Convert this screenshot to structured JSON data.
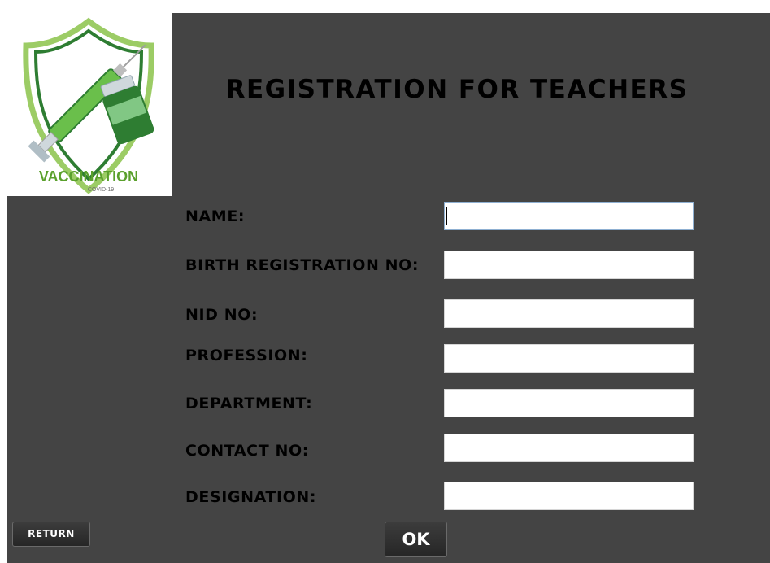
{
  "logo": {
    "text": "VACCINATION",
    "subtext": "COVID-19",
    "icon": "vaccination-shield-syringe-vial"
  },
  "title": "REGISTRATION FOR TEACHERS",
  "form": {
    "fields": [
      {
        "label": "NAME:",
        "value": ""
      },
      {
        "label": "BIRTH REGISTRATION NO:",
        "value": ""
      },
      {
        "label": "NID NO:",
        "value": ""
      },
      {
        "label": "PROFESSION:",
        "value": ""
      },
      {
        "label": "DEPARTMENT:",
        "value": ""
      },
      {
        "label": "CONTACT NO:",
        "value": ""
      },
      {
        "label": "DESIGNATION:",
        "value": ""
      }
    ]
  },
  "buttons": {
    "return_label": "RETURN",
    "ok_label": "OK"
  },
  "colors": {
    "panel_bg": "#444444",
    "logo_green": "#4caf50",
    "logo_dark_green": "#2e7d32"
  }
}
